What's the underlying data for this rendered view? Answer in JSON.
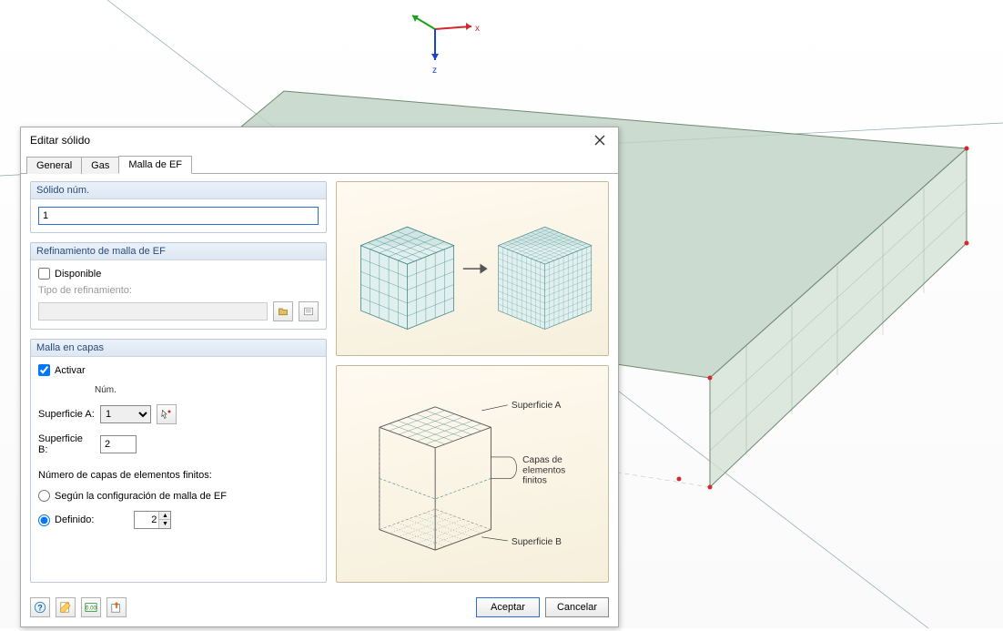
{
  "viewport": {
    "axis_x": "x",
    "axis_z": "z"
  },
  "dialog": {
    "title": "Editar sólido",
    "tabs": [
      {
        "label": "General"
      },
      {
        "label": "Gas"
      },
      {
        "label": "Malla de EF"
      }
    ],
    "active_tab": 2,
    "group_solido": {
      "header": "Sólido núm.",
      "value": "1"
    },
    "group_refine": {
      "header": "Refinamiento de malla de EF",
      "available_label": "Disponible",
      "available": false,
      "type_label": "Tipo de refinamiento:",
      "type_value": ""
    },
    "group_layers": {
      "header": "Malla en capas",
      "activate_label": "Activar",
      "activate": true,
      "num_col": "Núm.",
      "surfA_label": "Superficie A:",
      "surfA_value": "1",
      "surfB_label": "Superficie B:",
      "surfB_value": "2",
      "nlayers_label": "Número de capas de elementos finitos:",
      "opt_config": "Según la configuración de malla de EF",
      "opt_defined": "Definido:",
      "defined_value": "2"
    },
    "illus": {
      "surfA": "Superficie A",
      "surfB": "Superficie B",
      "layers_label": "Capas de\nelementos\nfinitos"
    },
    "footer": {
      "accept": "Aceptar",
      "cancel": "Cancelar"
    }
  }
}
